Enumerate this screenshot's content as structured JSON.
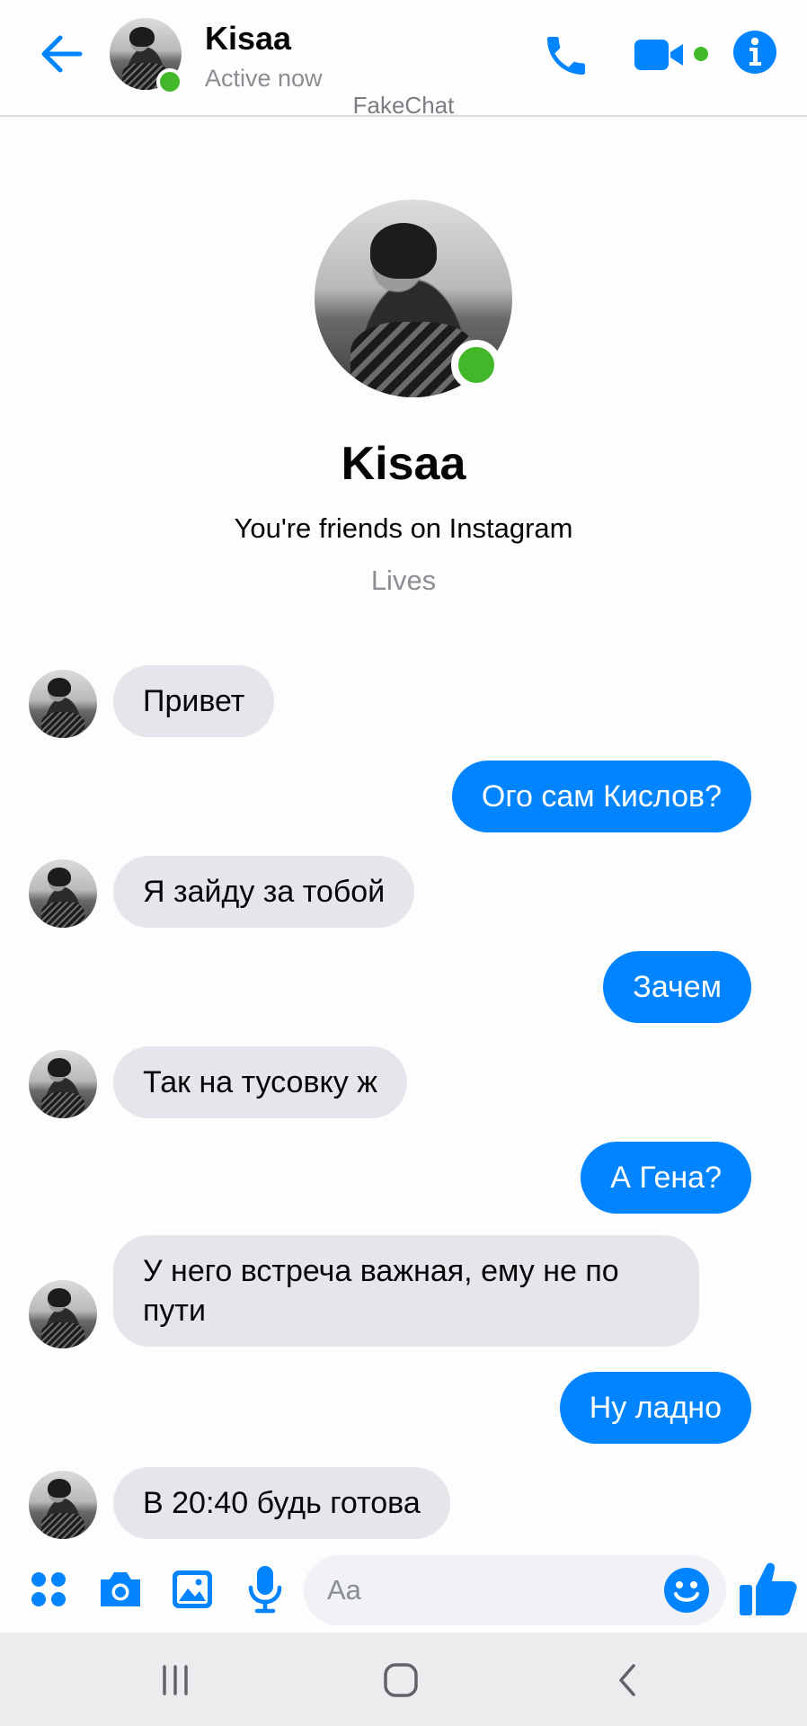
{
  "header": {
    "contact_name": "Kisaa",
    "status": "Active now",
    "watermark": "FakeChat",
    "icons": {
      "back": "back-arrow-icon",
      "call": "phone-icon",
      "video": "video-camera-icon",
      "info": "info-icon"
    }
  },
  "profile": {
    "name": "Kisaa",
    "subtitle": "You're friends on Instagram",
    "location": "Lives"
  },
  "messages": [
    {
      "direction": "in",
      "text": "Привет"
    },
    {
      "direction": "out",
      "text": "Ого сам Кислов?"
    },
    {
      "direction": "in",
      "text": "Я зайду за тобой"
    },
    {
      "direction": "out",
      "text": "Зачем"
    },
    {
      "direction": "in",
      "text": "Так на тусовку ж"
    },
    {
      "direction": "out",
      "text": "А Гена?"
    },
    {
      "direction": "in",
      "text": "У него встреча важная,  ему не по пути"
    },
    {
      "direction": "out",
      "text": "Ну ладно"
    },
    {
      "direction": "in",
      "text": "В 20:40 будь готова"
    }
  ],
  "composer": {
    "placeholder": "Aa",
    "icons": [
      "menu-dots-icon",
      "camera-icon",
      "gallery-icon",
      "microphone-icon",
      "emoji-icon",
      "thumbs-up-icon"
    ]
  },
  "navbar": {
    "icons": [
      "recent-apps-icon",
      "home-icon",
      "back-icon"
    ]
  },
  "colors": {
    "accent": "#0084ff",
    "incoming_bubble": "#e4e6eb",
    "online": "#42b72a",
    "secondary_text": "#8a8d91"
  }
}
